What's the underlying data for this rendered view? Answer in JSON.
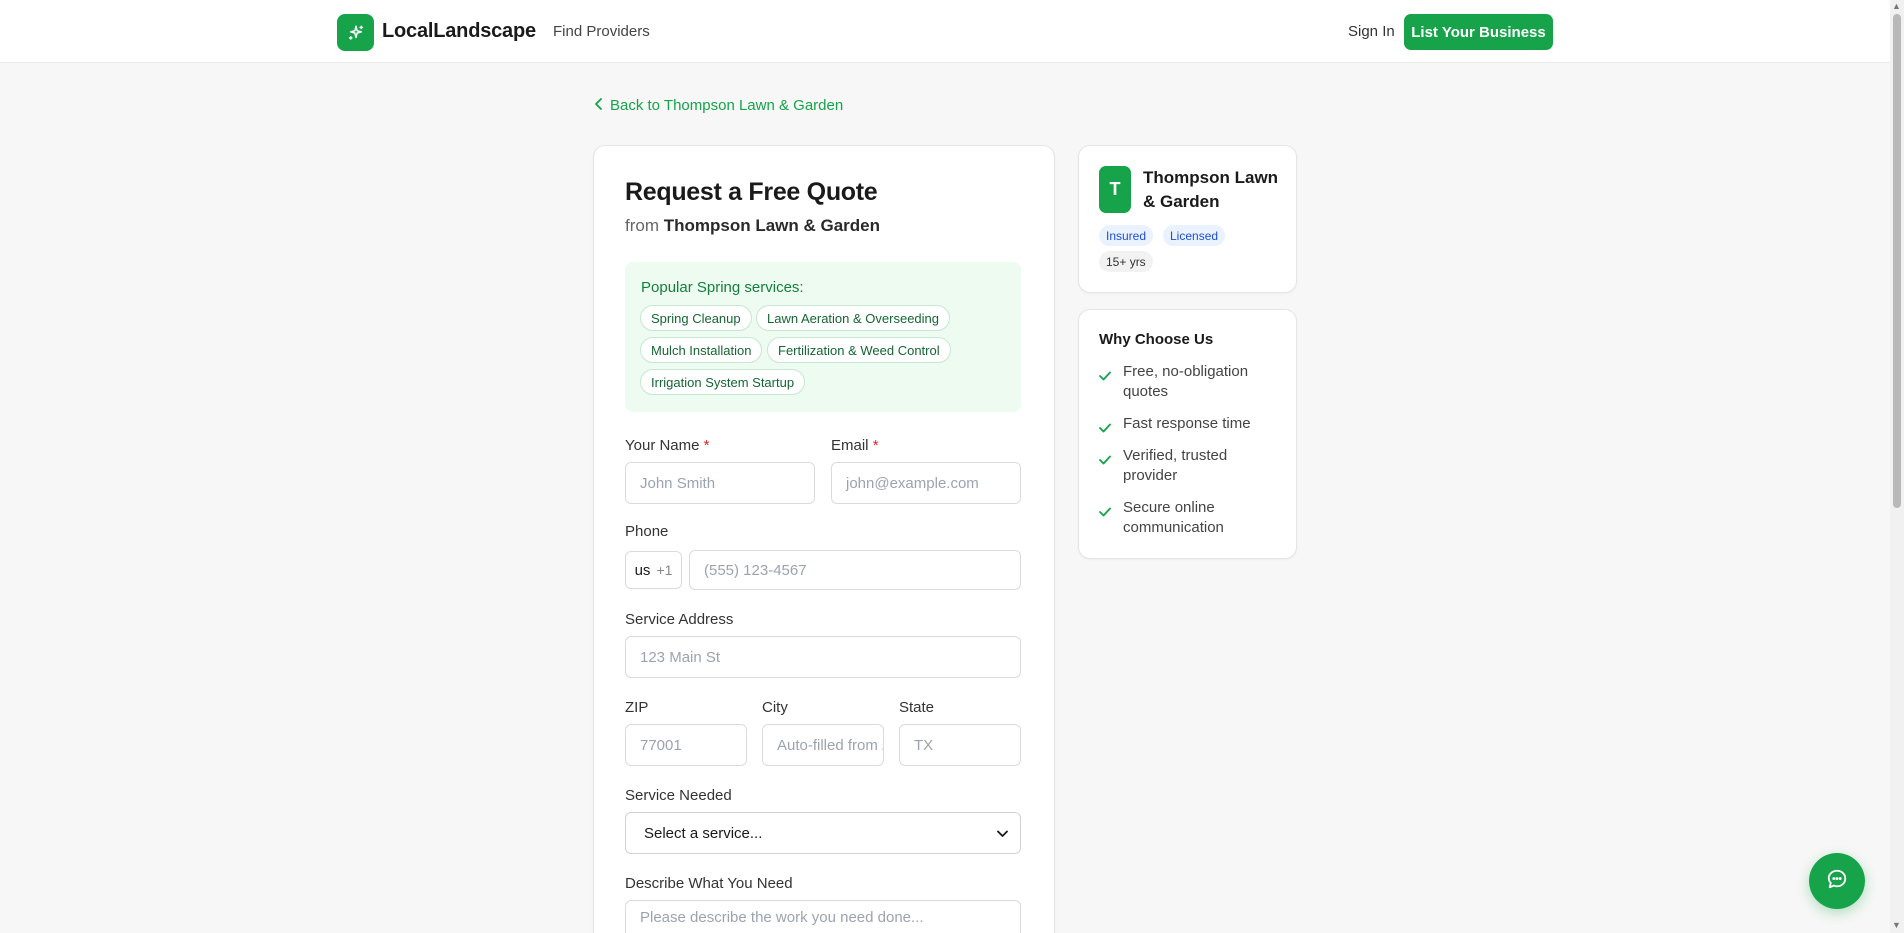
{
  "header": {
    "brand": "LocalLandscape",
    "nav_find": "Find Providers",
    "sign_in": "Sign In",
    "list_business": "List Your Business"
  },
  "back_link": "Back to Thompson Lawn & Garden",
  "form": {
    "title": "Request a Free Quote",
    "from_prefix": "from",
    "provider": "Thompson Lawn & Garden",
    "promo_title": "Popular Spring services:",
    "services": [
      "Spring Cleanup",
      "Lawn Aeration & Overseeding",
      "Mulch Installation",
      "Fertilization & Weed Control",
      "Irrigation System Startup"
    ],
    "name_label": "Your Name",
    "name_placeholder": "John Smith",
    "email_label": "Email",
    "email_placeholder": "john@example.com",
    "required_mark": "*",
    "phone_label": "Phone",
    "phone_country": "us",
    "phone_dial": "+1",
    "phone_placeholder": "(555) 123-4567",
    "address_label": "Service Address",
    "address_placeholder": "123 Main St",
    "zip_label": "ZIP",
    "zip_placeholder": "77001",
    "city_label": "City",
    "city_placeholder": "Auto-filled from ZIP",
    "state_label": "State",
    "state_placeholder": "TX",
    "service_label": "Service Needed",
    "service_selected": "Select a service...",
    "describe_label": "Describe What You Need",
    "describe_placeholder": "Please describe the work you need done..."
  },
  "provider_card": {
    "initial": "T",
    "name": "Thompson Lawn & Garden",
    "badges": [
      "Insured",
      "Licensed",
      "15+ yrs"
    ]
  },
  "why": {
    "title": "Why Choose Us",
    "items": [
      "Free, no-obligation quotes",
      "Fast response time",
      "Verified, trusted provider",
      "Secure online communication"
    ]
  },
  "colors": {
    "accent": "#16a34a",
    "promo_bg": "#edfbf1",
    "badge_blue": "#1d4ed8",
    "required": "#dc2626"
  }
}
